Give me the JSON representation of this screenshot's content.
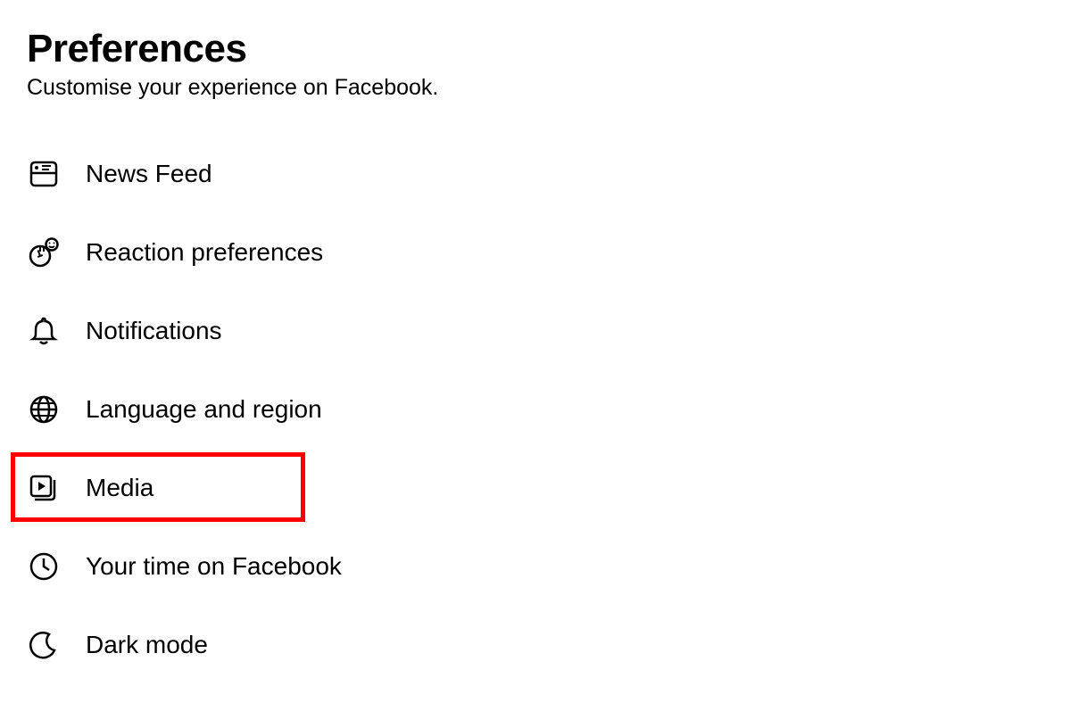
{
  "header": {
    "title": "Preferences",
    "subtitle": "Customise your experience on Facebook."
  },
  "menu": {
    "items": [
      {
        "label": "News Feed",
        "icon": "news-feed-icon"
      },
      {
        "label": "Reaction preferences",
        "icon": "reaction-icon"
      },
      {
        "label": "Notifications",
        "icon": "bell-icon"
      },
      {
        "label": "Language and region",
        "icon": "globe-icon"
      },
      {
        "label": "Media",
        "icon": "media-icon",
        "highlighted": true
      },
      {
        "label": "Your time on Facebook",
        "icon": "clock-icon"
      },
      {
        "label": "Dark mode",
        "icon": "moon-icon"
      }
    ]
  },
  "highlight_color": "#ff0000"
}
